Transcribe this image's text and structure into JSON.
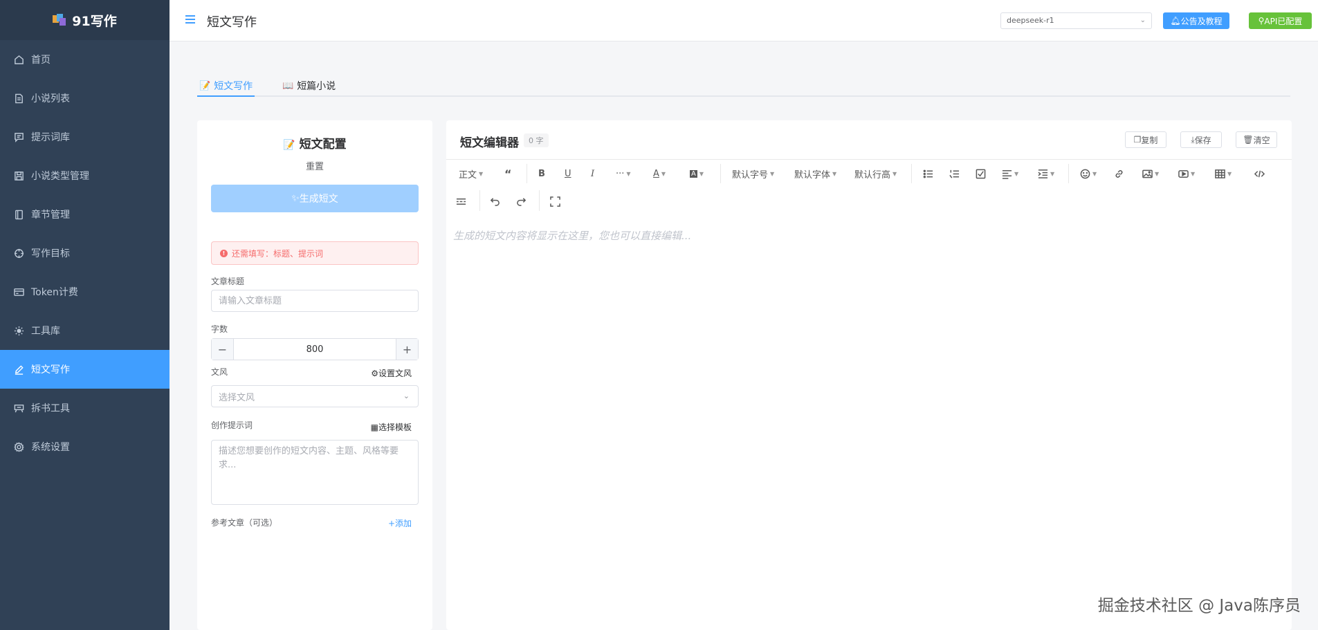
{
  "app": {
    "name": "91写作"
  },
  "sidebar": {
    "items": [
      {
        "label": "首页",
        "icon": "home-icon"
      },
      {
        "label": "小说列表",
        "icon": "document-icon"
      },
      {
        "label": "提示词库",
        "icon": "message-icon"
      },
      {
        "label": "小说类型管理",
        "icon": "save-icon"
      },
      {
        "label": "章节管理",
        "icon": "book-icon"
      },
      {
        "label": "写作目标",
        "icon": "target-icon"
      },
      {
        "label": "Token计费",
        "icon": "card-icon"
      },
      {
        "label": "工具库",
        "icon": "gear-icon"
      },
      {
        "label": "短文写作",
        "icon": "edit-icon",
        "active": true
      },
      {
        "label": "拆书工具",
        "icon": "scissors-icon"
      },
      {
        "label": "系统设置",
        "icon": "settings-icon"
      }
    ]
  },
  "header": {
    "title": "短文写作",
    "model_select": "deepseek-r1",
    "notice_button": "公告及教程",
    "api_button": "API已配置"
  },
  "tabs": [
    {
      "label": "短文写作",
      "active": true
    },
    {
      "label": "短篇小说",
      "active": false
    }
  ],
  "config": {
    "title": "短文配置",
    "reset": "重置",
    "generate_button": "生成短文",
    "alert": "还需填写：标题、提示词",
    "title_label": "文章标题",
    "title_placeholder": "请输入文章标题",
    "word_count_label": "字数",
    "word_count_value": "800",
    "style_label": "文风",
    "set_style_link": "设置文风",
    "style_placeholder": "选择文风",
    "prompt_label": "创作提示词",
    "choose_template_link": "选择模板",
    "prompt_placeholder": "描述您想要创作的短文内容、主题、风格等要求...",
    "reference_label": "参考文章（可选）",
    "add_link": "+添加"
  },
  "editor": {
    "title": "短文编辑器",
    "word_badge": "0 字",
    "copy_button": "复制",
    "save_button": "保存",
    "clear_button": "清空",
    "toolbar": {
      "paragraph": "正文",
      "font_size": "默认字号",
      "font_family": "默认字体",
      "line_height": "默认行高"
    },
    "content_placeholder": "生成的短文内容将显示在这里，您也可以直接编辑..."
  },
  "watermark": "掘金技术社区 @ Java陈序员",
  "colors": {
    "primary": "#409eff",
    "success": "#67c23a",
    "danger": "#f56c6c",
    "sidebar": "#304156"
  }
}
